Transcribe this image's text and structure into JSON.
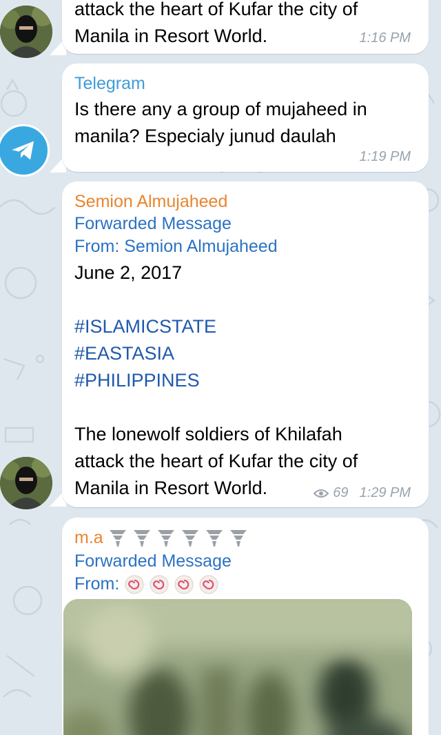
{
  "messages": [
    {
      "text": "attack the heart of Kufar the city of\nManila in Resort World.",
      "line1": "attack the heart of Kufar the city of",
      "line2": "Manila in Resort World.",
      "time": "1:16 PM"
    },
    {
      "sender": "Telegram",
      "line1": "Is there any a group of mujaheed in",
      "line2": "manila? Especialy junud daulah",
      "time": "1:19 PM"
    },
    {
      "sender": "Semion Almujaheed",
      "forwarded_label": "Forwarded Message",
      "from_label": "From:",
      "from_name": "Semion Almujaheed",
      "date": "June 2, 2017",
      "hashtags": [
        "#ISLAMICSTATE",
        "#EASTASIA",
        "#PHILIPPINES"
      ],
      "body_line1": "The lonewolf soldiers of Khilafah",
      "body_line2": "attack the heart of Kufar the city of",
      "body_line3": "Manila in Resort World.",
      "views": "69",
      "time": "1:29 PM"
    },
    {
      "sender": "m.a",
      "sender_emoji_icon": "tornado-icon",
      "forwarded_label": "Forwarded Message",
      "from_label": "From:",
      "from_emoji_icon": "fish-cake-icon"
    }
  ],
  "colors": {
    "background": "#dfe7ee",
    "bubble": "#ffffff",
    "telegram_blue": "#3aa8e0",
    "sender_orange": "#e8852f",
    "link_blue": "#2b72c2",
    "hashtag_blue": "#1f59ab",
    "meta_gray": "#99a3ad"
  }
}
